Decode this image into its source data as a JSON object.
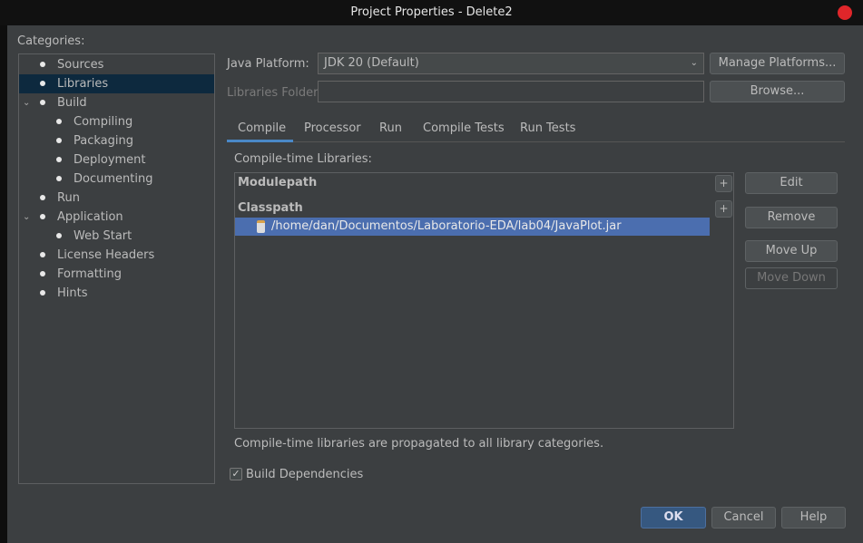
{
  "window": {
    "title": "Project Properties - Delete2"
  },
  "categories": {
    "label": "Categories:",
    "items": [
      {
        "label": "Sources",
        "level": 0,
        "expanded": null,
        "selected": false
      },
      {
        "label": "Libraries",
        "level": 0,
        "expanded": null,
        "selected": true
      },
      {
        "label": "Build",
        "level": 0,
        "expanded": true,
        "selected": false
      },
      {
        "label": "Compiling",
        "level": 1,
        "expanded": null,
        "selected": false
      },
      {
        "label": "Packaging",
        "level": 1,
        "expanded": null,
        "selected": false
      },
      {
        "label": "Deployment",
        "level": 1,
        "expanded": null,
        "selected": false
      },
      {
        "label": "Documenting",
        "level": 1,
        "expanded": null,
        "selected": false
      },
      {
        "label": "Run",
        "level": 0,
        "expanded": null,
        "selected": false
      },
      {
        "label": "Application",
        "level": 0,
        "expanded": true,
        "selected": false
      },
      {
        "label": "Web Start",
        "level": 1,
        "expanded": null,
        "selected": false
      },
      {
        "label": "License Headers",
        "level": 0,
        "expanded": null,
        "selected": false
      },
      {
        "label": "Formatting",
        "level": 0,
        "expanded": null,
        "selected": false
      },
      {
        "label": "Hints",
        "level": 0,
        "expanded": null,
        "selected": false
      }
    ]
  },
  "platform": {
    "label": "Java Platform:",
    "value": "JDK 20 (Default)",
    "manage": "Manage Platforms..."
  },
  "folder": {
    "label": "Libraries Folder:",
    "value": "",
    "browse": "Browse..."
  },
  "tabs": [
    "Compile",
    "Processor",
    "Run",
    "Compile Tests",
    "Run Tests"
  ],
  "compile": {
    "label": "Compile-time Libraries:",
    "modulepath": "Modulepath",
    "classpath": "Classpath",
    "plus": "+",
    "entry": "/home/dan/Documentos/Laboratorio-EDA/lab04/JavaPlot.jar",
    "note": "Compile-time libraries are propagated to all library categories."
  },
  "side_buttons": {
    "edit": "Edit",
    "remove": "Remove",
    "up": "Move Up",
    "down": "Move Down"
  },
  "build_deps": {
    "label": "Build Dependencies",
    "checked": true,
    "mark": "✓"
  },
  "footer": {
    "ok": "OK",
    "cancel": "Cancel",
    "help": "Help"
  }
}
